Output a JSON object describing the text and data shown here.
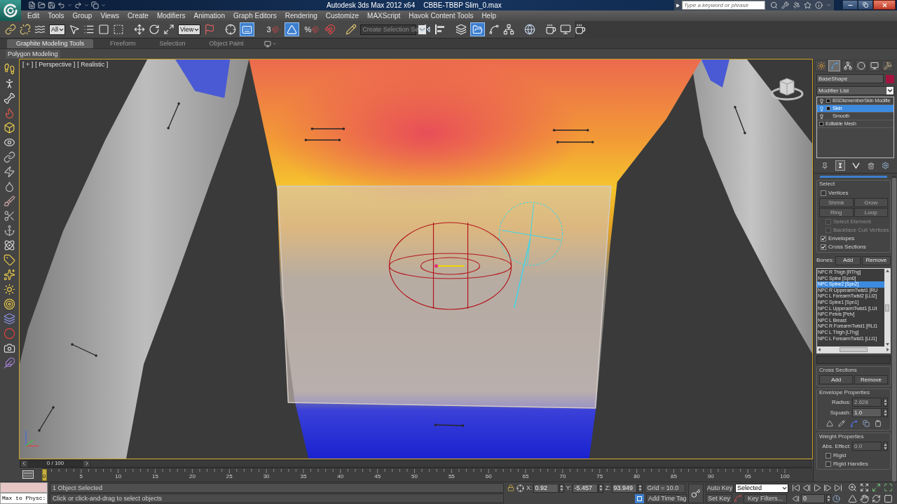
{
  "title_bar": {
    "app_title": "Autodesk 3ds Max 2012 x64",
    "file_name": "CBBE-TBBP Slim_0.max",
    "search": {
      "placeholder": "Type a keyword or phrase"
    }
  },
  "menu_bar": [
    "Edit",
    "Tools",
    "Group",
    "Views",
    "Create",
    "Modifiers",
    "Animation",
    "Graph Editors",
    "Rendering",
    "Customize",
    "MAXScript",
    "Havok Content Tools",
    "Help"
  ],
  "main_toolbar": {
    "selection_filter": "All",
    "reference_coordinate_system": "View",
    "keyboard_shortcut_override_on": true,
    "snap_label": "3",
    "angle_snap_on": true,
    "percent_snap_label": "%",
    "named_selection_set": "Create Selection Se",
    "ribbon_toggle_on": true
  },
  "ribbon": {
    "tabs": [
      {
        "label": "Graphite Modeling Tools",
        "selected": true
      },
      {
        "label": "Freeform",
        "selected": false
      },
      {
        "label": "Selection",
        "selected": false
      },
      {
        "label": "Object Paint",
        "selected": false
      }
    ],
    "panel_label": "Polygon Modeling"
  },
  "viewport": {
    "menus": [
      "[ + ]",
      "[ Perspective ]",
      "[ Realistic ]"
    ]
  },
  "command_panel": {
    "tabs": [
      {
        "kind": "create",
        "selected": false
      },
      {
        "kind": "modify",
        "selected": true
      },
      {
        "kind": "hierarchy",
        "selected": false
      },
      {
        "kind": "motion",
        "selected": false
      },
      {
        "kind": "display",
        "selected": false
      },
      {
        "kind": "utilities",
        "selected": false
      }
    ],
    "object_name": "BaseShape",
    "modifier_list": "Modifier List",
    "modifier_stack": [
      {
        "kind": "modifier",
        "label": "BSDismemberSkin Modifie",
        "expandable": true,
        "selected": false
      },
      {
        "kind": "modifier",
        "label": "Skin",
        "expandable": true,
        "selected": true
      },
      {
        "kind": "modifier",
        "label": "Smooth",
        "expandable": false,
        "selected": false
      },
      {
        "kind": "base",
        "label": "Editable Mesh",
        "expandable": true,
        "selected": false
      }
    ],
    "show_end_result_on": true,
    "select_group": {
      "title": "Select",
      "vertices": {
        "label": "Vertices",
        "checked": false
      },
      "buttons": [
        {
          "label": "Shrink",
          "disabled": true
        },
        {
          "label": "Grow",
          "disabled": true
        },
        {
          "label": "Ring",
          "disabled": true
        },
        {
          "label": "Loop",
          "disabled": true
        }
      ],
      "options": [
        {
          "label": "Select Element",
          "checked": false,
          "disabled": true
        },
        {
          "label": "Backface Cull Vertices",
          "checked": false,
          "disabled": true
        },
        {
          "label": "Envelopes",
          "checked": true,
          "disabled": false
        },
        {
          "label": "Cross Sections",
          "checked": true,
          "disabled": false
        }
      ]
    },
    "bones": {
      "label": "Bones:",
      "add": "Add",
      "remove": "Remove",
      "list": [
        {
          "label": "NPC R Thigh [RThg]",
          "selected": false
        },
        {
          "label": "NPC Spine [Spn0]",
          "selected": false
        },
        {
          "label": "NPC Spine2 [Spn2]",
          "selected": true
        },
        {
          "label": "NPC R UpperarmTwist1 [RU",
          "selected": false
        },
        {
          "label": "NPC L ForearmTwist2 [LLt2]",
          "selected": false
        },
        {
          "label": "NPC Spine1 [Spn1]",
          "selected": false
        },
        {
          "label": "NPC L UpperarmTwist1 [LUt",
          "selected": false
        },
        {
          "label": "NPC Pelvis [Pelv]",
          "selected": false
        },
        {
          "label": "NPC L Breast",
          "selected": false
        },
        {
          "label": "NPC R ForearmTwist1 [RLt1",
          "selected": false
        },
        {
          "label": "NPC L Thigh [LThg]",
          "selected": false
        },
        {
          "label": "NPC L ForearmTwist1 [LLt1]",
          "selected": false
        }
      ]
    },
    "cross_sections": {
      "title": "Cross Sections",
      "add": "Add",
      "remove": "Remove"
    },
    "envelope_properties": {
      "title": "Envelope Properties",
      "radius": {
        "label": "Radius:",
        "value": "2.628",
        "disabled": true
      },
      "squash": {
        "label": "Squash:",
        "value": "1.0",
        "disabled": false
      }
    },
    "weight_properties": {
      "title": "Weight Properties",
      "abs_effect": {
        "label": "Abs. Effect:",
        "value": "0.0",
        "disabled": true
      },
      "options": [
        {
          "label": "Rigid",
          "checked": false
        },
        {
          "label": "Rigid Handles",
          "checked": false
        }
      ]
    }
  },
  "time_slider": {
    "position": "0 / 100",
    "level": 0
  },
  "track_bar": {
    "labels": [
      "0",
      "5",
      "10",
      "15",
      "20",
      "25",
      "30",
      "35",
      "40",
      "45",
      "50",
      "55",
      "60",
      "65",
      "70",
      "75",
      "80",
      "85",
      "90",
      "95",
      "100"
    ]
  },
  "status_bar": {
    "listener_text": "Max to Physc:",
    "selection_info": "1 Object Selected",
    "prompt": "Click or click-and-drag to select objects",
    "x": {
      "label": "X:",
      "value": "0.92"
    },
    "y": {
      "label": "Y:",
      "value": "-5.457"
    },
    "z": {
      "label": "Z:",
      "value": "93.949"
    },
    "grid": "Grid = 10.0",
    "add_time_tag": "Add Time Tag",
    "auto_key": "Auto Key",
    "key_mode": "Selected",
    "set_key": "Set Key",
    "key_filters": "Key Filters...",
    "current_frame": "0"
  }
}
